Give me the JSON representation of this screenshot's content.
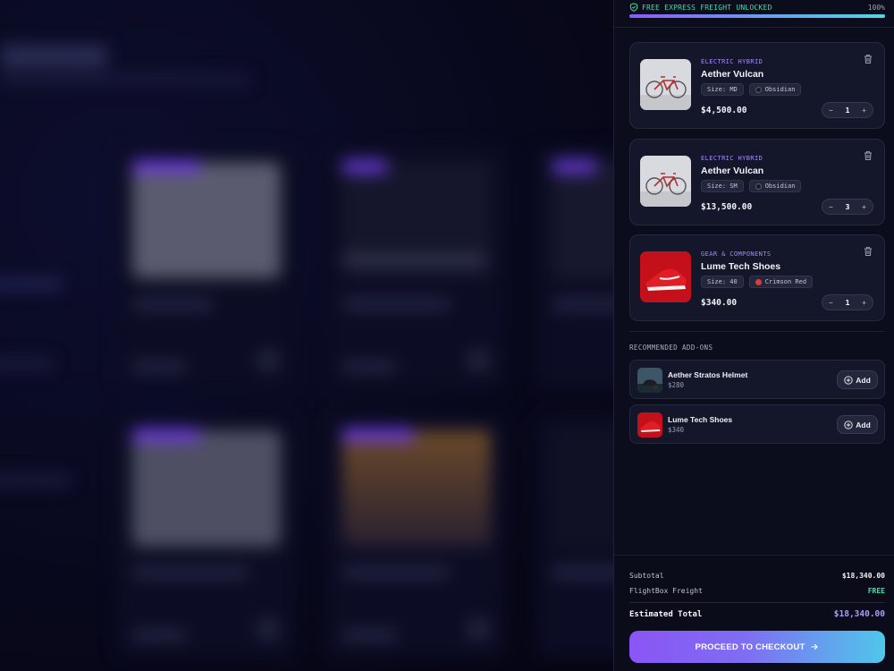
{
  "freight_banner": {
    "label": "FREE EXPRESS FREIGHT UNLOCKED",
    "percent_text": "100%",
    "progress": 1.0,
    "icon": "shield-check-icon",
    "accent": "#44dca5"
  },
  "cart_items": [
    {
      "category": "ELECTRIC HYBRID",
      "name": "Aether Vulcan",
      "size": "Size: MD",
      "color": "Obsidian",
      "color_hex": "#1a1a1a",
      "price": "$4,500.00",
      "quantity": "1",
      "image": "bicycle-image"
    },
    {
      "category": "ELECTRIC HYBRID",
      "name": "Aether Vulcan",
      "size": "Size: SM",
      "color": "Obsidian",
      "color_hex": "#1a1a1a",
      "price": "$13,500.00",
      "quantity": "3",
      "image": "bicycle-image"
    },
    {
      "category": "GEAR & COMPONENTS",
      "name": "Lume Tech Shoes",
      "size": "Size: 40",
      "color": "Crimson Red",
      "color_hex": "#e23a3a",
      "price": "$340.00",
      "quantity": "1",
      "image": "red-shoes-image"
    }
  ],
  "quantity_controls": {
    "decrement": "−",
    "increment": "+"
  },
  "recommended": {
    "heading": "RECOMMENDED ADD-ONS",
    "items": [
      {
        "name": "Aether Stratos Helmet",
        "price": "$280",
        "button": "Add",
        "image": "helmet-image"
      },
      {
        "name": "Lume Tech Shoes",
        "price": "$340",
        "button": "Add",
        "image": "red-shoes-image"
      }
    ]
  },
  "summary": {
    "subtotal_label": "Subtotal",
    "subtotal_value": "$18,340.00",
    "freight_label": "FlightBox Freight",
    "freight_value": "FREE",
    "total_label": "Estimated Total",
    "total_value": "$18,340.00"
  },
  "checkout_button": {
    "label": "PROCEED TO CHECKOUT",
    "icon": "arrow-right-icon"
  },
  "colors": {
    "accent_purple": "#8a55f5",
    "accent_cyan": "#4fc7ea",
    "success_green": "#44dca5",
    "panel_bg": "#0c0d1c"
  }
}
